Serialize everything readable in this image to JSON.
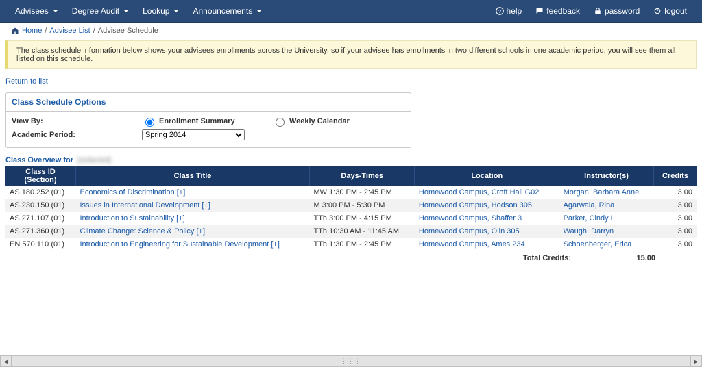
{
  "nav": {
    "left": [
      {
        "label": "Advisees"
      },
      {
        "label": "Degree Audit"
      },
      {
        "label": "Lookup"
      },
      {
        "label": "Announcements"
      }
    ],
    "right": {
      "help": "help",
      "feedback": "feedback",
      "password": "password",
      "logout": "logout"
    }
  },
  "breadcrumb": {
    "home": "Home",
    "sep": "/",
    "advisee_list": "Advisee List",
    "advisee_schedule": "Advisee Schedule"
  },
  "alert": "The class schedule information below shows your advisees enrollments across the University, so if your advisee has enrollments in two different schools in one academic period, you will see them all listed on this schedule.",
  "return_link": "Return to list",
  "panel": {
    "title": "Class Schedule Options",
    "view_by_label": "View By:",
    "opt_enroll": "Enrollment Summary",
    "opt_weekly": "Weekly Calendar",
    "period_label": "Academic Period:",
    "period_value": "Spring 2014"
  },
  "overview_label": "Class Overview for",
  "overview_name": "[redacted]",
  "headers": {
    "classid": "Class ID (Section)",
    "title": "Class Title",
    "days": "Days-Times",
    "location": "Location",
    "instructors": "Instructor(s)",
    "credits": "Credits"
  },
  "rows": [
    {
      "id": "AS.180.252 (01)",
      "title": "Economics of Discrimination [+]",
      "days": "MW 1:30 PM - 2:45 PM",
      "loc": "Homewood Campus, Croft Hall G02",
      "inst": "Morgan, Barbara Anne",
      "cr": "3.00"
    },
    {
      "id": "AS.230.150 (01)",
      "title": "Issues in International Development [+]",
      "days": "M 3:00 PM - 5:30 PM",
      "loc": "Homewood Campus, Hodson 305",
      "inst": "Agarwala, Rina",
      "cr": "3.00"
    },
    {
      "id": "AS.271.107 (01)",
      "title": "Introduction to Sustainability [+]",
      "days": "TTh 3:00 PM - 4:15 PM",
      "loc": "Homewood Campus, Shaffer 3",
      "inst": "Parker, Cindy L",
      "cr": "3.00"
    },
    {
      "id": "AS.271.360 (01)",
      "title": "Climate Change: Science & Policy [+]",
      "days": "TTh 10:30 AM - 11:45 AM",
      "loc": "Homewood Campus, Olin 305",
      "inst": "Waugh, Darryn",
      "cr": "3.00"
    },
    {
      "id": "EN.570.110 (01)",
      "title": "Introduction to Engineering for Sustainable Development [+]",
      "days": "TTh 1:30 PM - 2:45 PM",
      "loc": "Homewood Campus, Ames 234",
      "inst": "Schoenberger, Erica",
      "cr": "3.00"
    }
  ],
  "total_label": "Total Credits:",
  "total_value": "15.00"
}
